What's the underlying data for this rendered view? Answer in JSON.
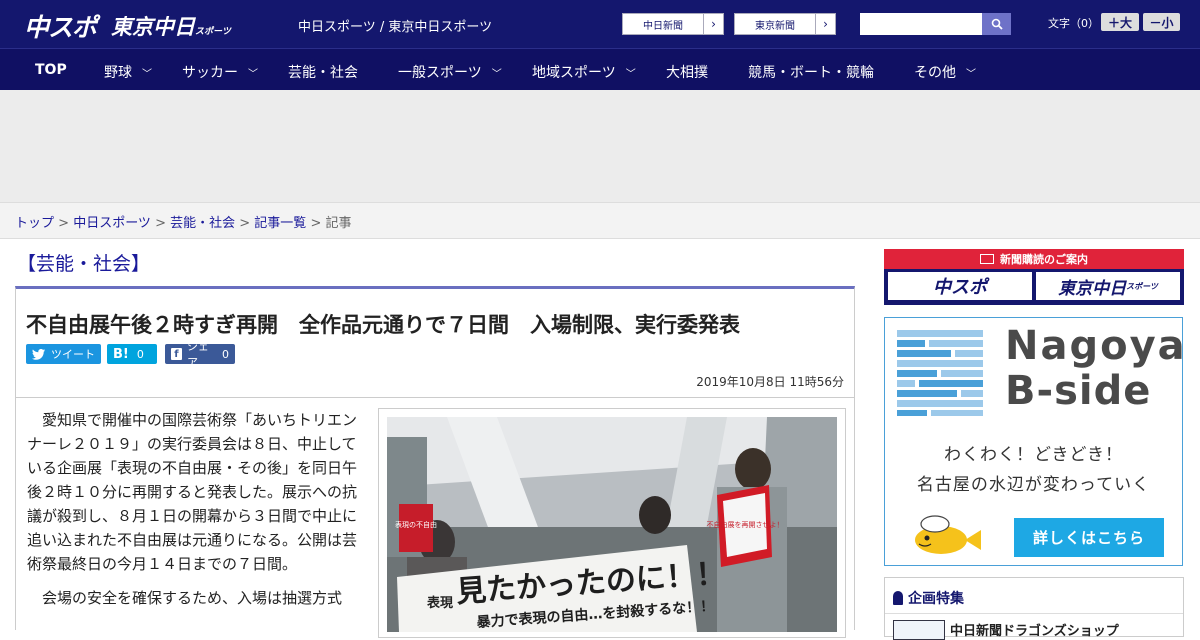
{
  "header": {
    "logo_main": "中スポ",
    "logo_tokyo": "東京中日",
    "logo_tokyo_sub": "スポーツ",
    "site_links": "中日スポーツ / 東京中日スポーツ",
    "ext_links": [
      "中日新聞",
      "東京新聞"
    ],
    "search_placeholder": "",
    "font_size_label": "文字（0）",
    "font_up": "＋大",
    "font_down": "－小"
  },
  "nav": {
    "items": [
      {
        "label": "TOP",
        "dropdown": false
      },
      {
        "label": "野球",
        "dropdown": true
      },
      {
        "label": "サッカー",
        "dropdown": true
      },
      {
        "label": "芸能・社会",
        "dropdown": false
      },
      {
        "label": "一般スポーツ",
        "dropdown": true
      },
      {
        "label": "地域スポーツ",
        "dropdown": true
      },
      {
        "label": "大相撲",
        "dropdown": false
      },
      {
        "label": "競馬・ボート・競輪",
        "dropdown": false
      },
      {
        "label": "その他",
        "dropdown": true
      }
    ]
  },
  "breadcrumb": {
    "items": [
      "トップ",
      "中日スポーツ",
      "芸能・社会",
      "記事一覧"
    ],
    "current": "記事",
    "sep": " > "
  },
  "article": {
    "section": "【芸能・社会】",
    "headline": "不自由展午後２時すぎ再開　全作品元通りで７日間　入場制限、実行委発表",
    "tweet": "ツイート",
    "hatena_b": "B!",
    "hatena_count": "0",
    "share": "シェア",
    "share_count": "0",
    "date": "2019年10月8日 11時56分",
    "paragraphs": [
      "愛知県で開催中の国際芸術祭「あいちトリエンナーレ２０１９」の実行委員会は８日、中止している企画展「表現の不自由展・その後」を同日午後２時１０分に再開すると発表した。展示への抗議が殺到し、８月１日の開幕から３日間で中止に追い込まれた不自由展は元通りになる。公開は芸術祭最終日の今月１４日までの７日間。",
      "会場の安全を確保するため、入場は抽選方式"
    ],
    "photo_banner_text": "見たかったのに！！",
    "photo_banner_text2": "暴力で表現の自由…を封殺するな！！",
    "photo_sign_left": "表現",
    "photo_sign_red": "表現の不自由",
    "photo_sign_right": "不自由展を再開させよ！"
  },
  "sidebar": {
    "subscribe_head": "新聞購読のご案内",
    "subscribe_left": "中スポ",
    "subscribe_right": "東京中日",
    "subscribe_right_sub": "スポーツ",
    "bside_title1": "Nagoya",
    "bside_title2": "B-side",
    "bside_copy1": "わくわく！どきどき！",
    "bside_copy2": "名古屋の水辺が変わっていく",
    "bside_button": "詳しくはこちら",
    "feature_head": "企画特集",
    "feature_item": "中日新聞ドラゴンズショップ"
  },
  "colors": {
    "brand_navy": "#14176e",
    "accent_red": "#e0233a",
    "bside_blue": "#1ea8e4",
    "twitter": "#1b95e0",
    "hatena": "#00a4de",
    "facebook": "#3b5998"
  }
}
